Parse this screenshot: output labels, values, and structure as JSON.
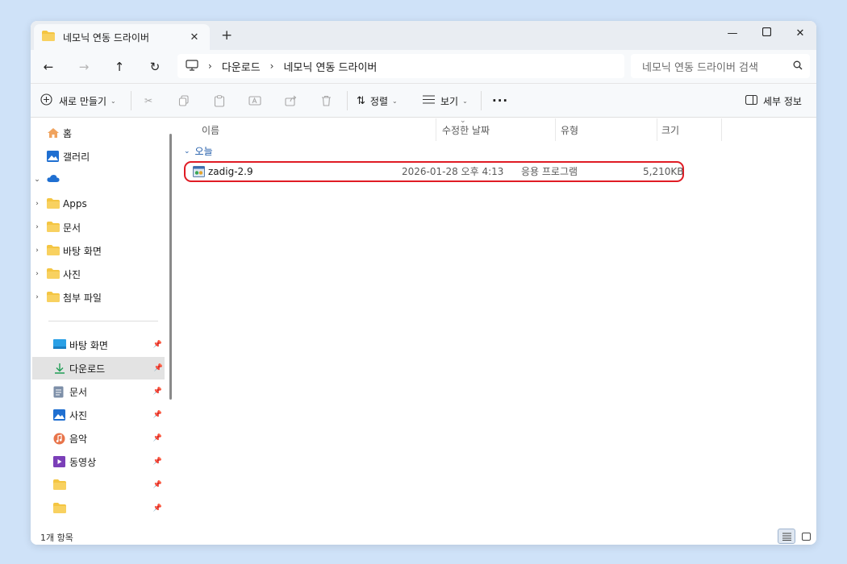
{
  "tab": {
    "title": "네모닉 연동 드라이버"
  },
  "address": {
    "crumbs": [
      "다운로드",
      "네모닉 연동 드라이버"
    ]
  },
  "search": {
    "placeholder": "네모닉 연동 드라이버 검색"
  },
  "toolbar": {
    "new_label": "새로 만들기",
    "sort_label": "정렬",
    "view_label": "보기",
    "details_label": "세부 정보"
  },
  "sidebar": {
    "top_items": [
      "홈",
      "갤러리"
    ],
    "tree_items": [
      "Apps",
      "문서",
      "바탕 화면",
      "사진",
      "첨부 파일"
    ],
    "quick_items": [
      "바탕 화면",
      "다운로드",
      "문서",
      "사진",
      "음악",
      "동영상",
      "",
      ""
    ]
  },
  "columns": {
    "name": "이름",
    "modified": "수정한 날짜",
    "type": "유형",
    "size": "크기"
  },
  "group": {
    "label": "오늘"
  },
  "file": {
    "name": "zadig-2.9",
    "modified": "2026-01-28 오후 4:13",
    "type": "응용 프로그램",
    "size": "5,210KB"
  },
  "status": {
    "count": "1개 항목"
  },
  "colors": {
    "highlight": "#e01b24",
    "folder": "#f4c542",
    "accent": "#1e5aa8"
  }
}
